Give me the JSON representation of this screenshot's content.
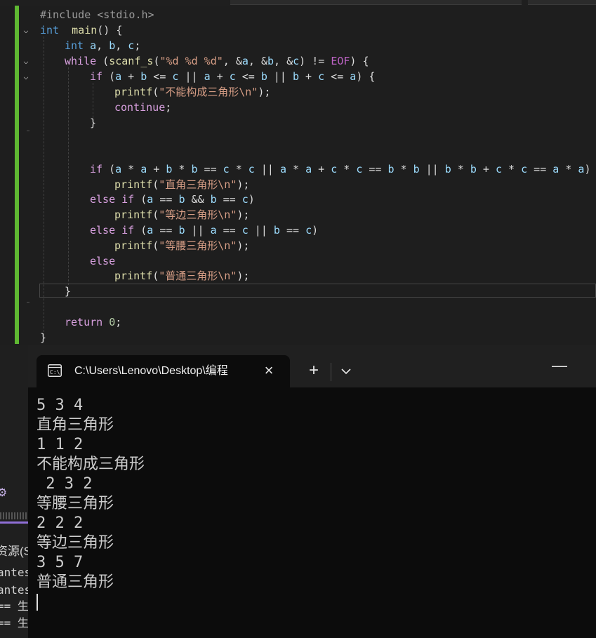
{
  "editor": {
    "lines": [
      {
        "id": "l1",
        "tokens": [
          [
            "inc",
            "#include <stdio.h>"
          ]
        ]
      },
      {
        "id": "l2",
        "tokens": [
          [
            "kw",
            "int"
          ],
          [
            "",
            "  "
          ],
          [
            "fn",
            "main"
          ],
          [
            "",
            "() {"
          ]
        ]
      },
      {
        "id": "l3",
        "tokens": [
          [
            "kw",
            "int"
          ],
          [
            "",
            ""
          ],
          [
            "var",
            " a"
          ],
          [
            "",
            ","
          ],
          [
            "var",
            " b"
          ],
          [
            "",
            ","
          ],
          [
            "var",
            " c"
          ],
          [
            "",
            ";"
          ]
        ]
      },
      {
        "id": "l4",
        "tokens": [
          [
            "ctl",
            "while"
          ],
          [
            "",
            " ("
          ],
          [
            "fn",
            "scanf_s"
          ],
          [
            "",
            "("
          ],
          [
            "str",
            "\"%d %d %d\""
          ],
          [
            "",
            ", &"
          ],
          [
            "var",
            "a"
          ],
          [
            "",
            ", &"
          ],
          [
            "var",
            "b"
          ],
          [
            "",
            ", &"
          ],
          [
            "var",
            "c"
          ],
          [
            "",
            ") != "
          ],
          [
            "mac",
            "EOF"
          ],
          [
            "",
            ") {"
          ]
        ]
      },
      {
        "id": "l5",
        "tokens": [
          [
            "ctl",
            "if"
          ],
          [
            "",
            " ("
          ],
          [
            "var",
            "a"
          ],
          [
            "",
            " + "
          ],
          [
            "var",
            "b"
          ],
          [
            "",
            " <= "
          ],
          [
            "var",
            "c"
          ],
          [
            "",
            " || "
          ],
          [
            "var",
            "a"
          ],
          [
            "",
            " + "
          ],
          [
            "var",
            "c"
          ],
          [
            "",
            " <= "
          ],
          [
            "var",
            "b"
          ],
          [
            "",
            " || "
          ],
          [
            "var",
            "b"
          ],
          [
            "",
            " + "
          ],
          [
            "var",
            "c"
          ],
          [
            "",
            " <= "
          ],
          [
            "var",
            "a"
          ],
          [
            "",
            ") {"
          ]
        ]
      },
      {
        "id": "l6",
        "tokens": [
          [
            "fn",
            "printf"
          ],
          [
            "",
            "("
          ],
          [
            "str",
            "\"不能构成三角形\\n\""
          ],
          [
            "",
            ");"
          ]
        ]
      },
      {
        "id": "l7",
        "tokens": [
          [
            "ctl",
            "continue"
          ],
          [
            "",
            ";"
          ]
        ]
      },
      {
        "id": "l8",
        "tokens": [
          [
            "",
            "}"
          ]
        ]
      },
      {
        "id": "l9",
        "tokens": [
          [
            "ctl",
            "if"
          ],
          [
            "",
            " ("
          ],
          [
            "var",
            "a"
          ],
          [
            "",
            " * "
          ],
          [
            "var",
            "a"
          ],
          [
            "",
            " + "
          ],
          [
            "var",
            "b"
          ],
          [
            "",
            " * "
          ],
          [
            "var",
            "b"
          ],
          [
            "",
            " == "
          ],
          [
            "var",
            "c"
          ],
          [
            "",
            " * "
          ],
          [
            "var",
            "c"
          ],
          [
            "",
            " || "
          ],
          [
            "var",
            "a"
          ],
          [
            "",
            " * "
          ],
          [
            "var",
            "a"
          ],
          [
            "",
            " + "
          ],
          [
            "var",
            "c"
          ],
          [
            "",
            " * "
          ],
          [
            "var",
            "c"
          ],
          [
            "",
            " == "
          ],
          [
            "var",
            "b"
          ],
          [
            "",
            " * "
          ],
          [
            "var",
            "b"
          ],
          [
            "",
            " || "
          ],
          [
            "var",
            "b"
          ],
          [
            "",
            " * "
          ],
          [
            "var",
            "b"
          ],
          [
            "",
            " + "
          ],
          [
            "var",
            "c"
          ],
          [
            "",
            " * "
          ],
          [
            "var",
            "c"
          ],
          [
            "",
            " == "
          ],
          [
            "var",
            "a"
          ],
          [
            "",
            " * "
          ],
          [
            "var",
            "a"
          ],
          [
            "",
            ")"
          ]
        ]
      },
      {
        "id": "l10",
        "tokens": [
          [
            "fn",
            "printf"
          ],
          [
            "",
            "("
          ],
          [
            "str",
            "\"直角三角形\\n\""
          ],
          [
            "",
            ");"
          ]
        ]
      },
      {
        "id": "l11",
        "tokens": [
          [
            "ctl",
            "else if"
          ],
          [
            "",
            " ("
          ],
          [
            "var",
            "a"
          ],
          [
            "",
            " == "
          ],
          [
            "var",
            "b"
          ],
          [
            "",
            " && "
          ],
          [
            "var",
            "b"
          ],
          [
            "",
            " == "
          ],
          [
            "var",
            "c"
          ],
          [
            "",
            ")"
          ]
        ]
      },
      {
        "id": "l12",
        "tokens": [
          [
            "fn",
            "printf"
          ],
          [
            "",
            "("
          ],
          [
            "str",
            "\"等边三角形\\n\""
          ],
          [
            "",
            ");"
          ]
        ]
      },
      {
        "id": "l13",
        "tokens": [
          [
            "ctl",
            "else if"
          ],
          [
            "",
            " ("
          ],
          [
            "var",
            "a"
          ],
          [
            "",
            " == "
          ],
          [
            "var",
            "b"
          ],
          [
            "",
            " || "
          ],
          [
            "var",
            "a"
          ],
          [
            "",
            " == "
          ],
          [
            "var",
            "c"
          ],
          [
            "",
            " || "
          ],
          [
            "var",
            "b"
          ],
          [
            "",
            " == "
          ],
          [
            "var",
            "c"
          ],
          [
            "",
            ")"
          ]
        ]
      },
      {
        "id": "l14",
        "tokens": [
          [
            "fn",
            "printf"
          ],
          [
            "",
            "("
          ],
          [
            "str",
            "\"等腰三角形\\n\""
          ],
          [
            "",
            ");"
          ]
        ]
      },
      {
        "id": "l15",
        "tokens": [
          [
            "ctl",
            "else"
          ]
        ]
      },
      {
        "id": "l16",
        "tokens": [
          [
            "fn",
            "printf"
          ],
          [
            "",
            "("
          ],
          [
            "str",
            "\"普通三角形\\n\""
          ],
          [
            "",
            ");"
          ]
        ]
      },
      {
        "id": "l17",
        "tokens": [
          [
            "",
            "}"
          ]
        ]
      },
      {
        "id": "l18",
        "tokens": [
          [
            "ctl",
            "return"
          ],
          [
            "",
            " "
          ],
          [
            "num",
            "0"
          ],
          [
            "",
            ";"
          ]
        ]
      },
      {
        "id": "l19",
        "tokens": [
          [
            "",
            "}"
          ]
        ]
      }
    ]
  },
  "left_panel": {
    "label": "资源(S)",
    "rows": [
      "antes",
      "antes",
      "== 生",
      "== 生"
    ]
  },
  "terminal": {
    "tab_title": "C:\\Users\\Lenovo\\Desktop\\编程",
    "close_icon": "×",
    "new_tab_icon": "+",
    "minimize_icon": "—",
    "output": [
      "5 3 4",
      "直角三角形",
      "1 1 2",
      "不能构成三角形",
      " 2 3 2",
      "等腰三角形",
      "2 2 2",
      "等边三角形",
      "3 5 7",
      "普通三角形"
    ]
  }
}
